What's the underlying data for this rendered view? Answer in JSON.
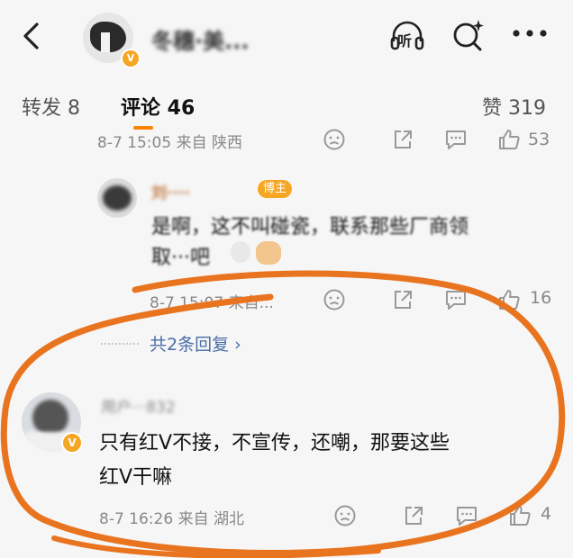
{
  "header": {
    "title": "冬穗·美...",
    "listen_label": "听"
  },
  "tabs": {
    "repost": "转发 8",
    "comments": "评论 46",
    "likes": "赞 319"
  },
  "comments": [
    {
      "meta": "8-7 15:05 来自 陕西",
      "likes": "53"
    },
    {
      "name": "刘····",
      "badge": "博主",
      "text_line1": "是啊，这不叫碰瓷，联系那些厂商领",
      "text_line2": "取···吧",
      "meta": "8-7 15:07 来自...",
      "likes": "16",
      "more_replies": "共2条回复 ›"
    },
    {
      "name": "用户···832",
      "text_line1": "只有红V不接，不宣传，还嘲，那要这些",
      "text_line2": "红V干嘛",
      "meta": "8-7 16:26 来自 湖北",
      "likes": "4"
    }
  ],
  "colors": {
    "accent": "#ff8200",
    "annotation": "#e9741f",
    "badge": "#f5a623",
    "link": "#4a6da7"
  }
}
